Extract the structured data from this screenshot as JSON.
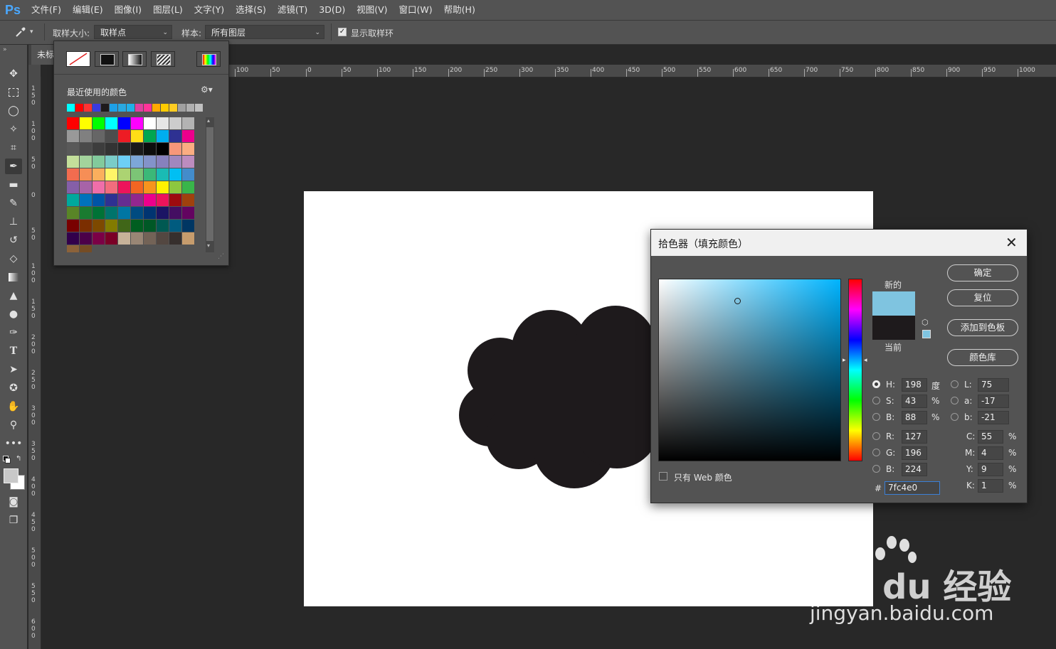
{
  "menubar": {
    "logo": "Ps",
    "items": [
      "文件(F)",
      "编辑(E)",
      "图像(I)",
      "图层(L)",
      "文字(Y)",
      "选择(S)",
      "滤镜(T)",
      "3D(D)",
      "视图(V)",
      "窗口(W)",
      "帮助(H)"
    ]
  },
  "options": {
    "sample_size_label": "取样大小:",
    "sample_size_value": "取样点",
    "sample_label": "样本:",
    "sample_value": "所有图层",
    "show_ring_label": "显示取样环",
    "show_ring_checked": true
  },
  "doc_tab": {
    "title": "未标"
  },
  "ruler": {
    "h_labels": [
      "100",
      "50",
      "0",
      "50",
      "100",
      "150",
      "200",
      "250",
      "300",
      "350",
      "400",
      "450",
      "500",
      "550",
      "600",
      "650",
      "700",
      "750",
      "800",
      "850",
      "900",
      "950",
      "1000"
    ],
    "v_labels": [
      "1\n5\n0",
      "1\n0\n0",
      "5\n0",
      "0",
      "5\n0",
      "1\n0\n0",
      "1\n5\n0",
      "2\n0\n0",
      "2\n5\n0",
      "3\n0\n0",
      "3\n5\n0",
      "4\n0\n0",
      "4\n5\n0",
      "5\n0\n0",
      "5\n5\n0",
      "6\n0\n0"
    ]
  },
  "swatch_panel": {
    "recent_title": "最近使用的颜色",
    "recent_colors": [
      "#00ffff",
      "#ff0000",
      "#ff3333",
      "#3a3ae0",
      "#1e1a1c",
      "#1ea0e6",
      "#29a8e0",
      "#20b0e8",
      "#e040a0",
      "#ff3399",
      "#ffaa00",
      "#ffcc00",
      "#ffcc22",
      "#a0a0a0",
      "#b0b0b0",
      "#c0c0c0"
    ],
    "grid_colors": [
      [
        "#ff0000",
        "#ffff00",
        "#00ff00",
        "#00ffff",
        "#0000ff",
        "#ff00ff",
        "#ffffff",
        "#e6e6e6",
        "#cccccc",
        "#b3b3b3"
      ],
      [
        "#999999",
        "#808080",
        "#666666",
        "#4d4d4d",
        "#ed1c24",
        "#ffde17",
        "#00a651",
        "#00aeef",
        "#2e3192",
        "#ec008c"
      ],
      [
        "#595959",
        "#4a4a4a",
        "#3d3d3d",
        "#333333",
        "#262626",
        "#1a1a1a",
        "#0d0d0d",
        "#000000",
        "#f7977a",
        "#fbad82"
      ],
      [
        "#c4df9b",
        "#a3d39c",
        "#82ca9c",
        "#7accc8",
        "#6dcff6",
        "#7da7d9",
        "#8393ca",
        "#8781bd",
        "#a187be",
        "#bd8cbf"
      ],
      [
        "#f26c4f",
        "#f68e56",
        "#fbaf5d",
        "#fff568",
        "#acd372",
        "#7cc576",
        "#3bb878",
        "#1abbb4",
        "#00bff3",
        "#438ccb"
      ],
      [
        "#855fa8",
        "#a763a8",
        "#f06ea9",
        "#f26d7d",
        "#ed145b",
        "#f26522",
        "#f7941d",
        "#fff200",
        "#8dc73f",
        "#39b54a"
      ],
      [
        "#00a99d",
        "#0072bc",
        "#0054a6",
        "#2e3192",
        "#662d91",
        "#92278f",
        "#ec008c",
        "#ed145b",
        "#9e0b0f",
        "#a0410d"
      ],
      [
        "#598527",
        "#1a7b30",
        "#007236",
        "#00746b",
        "#0076a3",
        "#004b80",
        "#003471",
        "#1b1464",
        "#440e62",
        "#630460"
      ],
      [
        "#790000",
        "#7b2e00",
        "#7d4900",
        "#827b00",
        "#406618",
        "#005e20",
        "#005826",
        "#005952",
        "#005b7f",
        "#003663"
      ],
      [
        "#32004b",
        "#4b0049",
        "#7b0046",
        "#7a0026",
        "#c7b299",
        "#998675",
        "#736357",
        "#534741",
        "#362f2d",
        "#c69c6d"
      ],
      [
        "#8c6239",
        "#754c24"
      ]
    ]
  },
  "picker": {
    "title": "拾色器（填充颜色）",
    "buttons": {
      "ok": "确定",
      "reset": "复位",
      "add_swatch": "添加到色板",
      "libraries": "颜色库"
    },
    "new_label": "新的",
    "current_label": "当前",
    "new_color": "#7fc4e0",
    "current_color": "#1e1a1c",
    "web_colors_label": "只有 Web 颜色",
    "web_colors_checked": false,
    "hsb": {
      "h": {
        "label": "H:",
        "value": "198",
        "unit": "度"
      },
      "s": {
        "label": "S:",
        "value": "43",
        "unit": "%"
      },
      "b": {
        "label": "B:",
        "value": "88",
        "unit": "%"
      }
    },
    "rgb": {
      "r": {
        "label": "R:",
        "value": "127"
      },
      "g": {
        "label": "G:",
        "value": "196"
      },
      "b": {
        "label": "B:",
        "value": "224"
      }
    },
    "lab": {
      "l": {
        "label": "L:",
        "value": "75"
      },
      "a": {
        "label": "a:",
        "value": "-17"
      },
      "b": {
        "label": "b:",
        "value": "-21"
      }
    },
    "cmyk": {
      "c": {
        "label": "C:",
        "value": "55",
        "unit": "%"
      },
      "m": {
        "label": "M:",
        "value": "4",
        "unit": "%"
      },
      "y": {
        "label": "Y:",
        "value": "9",
        "unit": "%"
      },
      "k": {
        "label": "K:",
        "value": "1",
        "unit": "%"
      }
    },
    "hex_label": "#",
    "hex_value": "7fc4e0",
    "field_hue_color": "#00b4ff",
    "selected_h": 198,
    "selected_s": 0.43,
    "selected_b": 0.88
  },
  "canvas": {
    "shape_color": "#1e1a1c"
  },
  "watermark": {
    "brand": "Bai du 经验",
    "url": "jingyan.baidu.com"
  }
}
